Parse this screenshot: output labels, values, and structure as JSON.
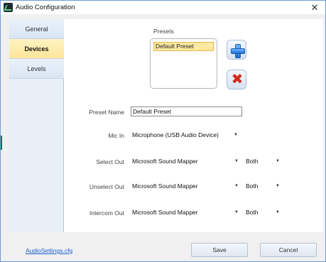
{
  "window": {
    "title": "Audio Configuration",
    "close_glyph": "✕"
  },
  "nav": {
    "tabs": [
      {
        "label": "General",
        "active": false
      },
      {
        "label": "Devices",
        "active": true
      },
      {
        "label": "Levels",
        "active": false
      }
    ]
  },
  "presets": {
    "label": "Presets",
    "items": [
      "Default Preset"
    ],
    "selected": "Default Preset",
    "add_icon": "plus-icon",
    "remove_icon": "x-icon",
    "remove_glyph": "✖"
  },
  "form": {
    "preset_name": {
      "label": "Preset Name",
      "value": "Default Preset"
    },
    "mic_in": {
      "label": "Mic In",
      "value": "Microphone (USB Audio Device)"
    },
    "select_out": {
      "label": "Select Out",
      "value": "Microsoft Sound Mapper",
      "channel": "Both"
    },
    "unselect_out": {
      "label": "Unselect Out",
      "value": "Microsoft Sound Mapper",
      "channel": "Both"
    },
    "intercom_out": {
      "label": "Intercom Out",
      "value": "Microsoft Sound Mapper",
      "channel": "Both"
    },
    "dropdown_glyph": "▼"
  },
  "footer": {
    "link": "AudioSettings.cfg",
    "save_label": "Save",
    "cancel_label": "Cancel"
  },
  "colors": {
    "accent": "#6d9bd3",
    "selected_tab": "#fde59a",
    "link": "#1a5fd0",
    "remove_red": "#d62a1b",
    "add_blue": "#1f6fd1"
  }
}
